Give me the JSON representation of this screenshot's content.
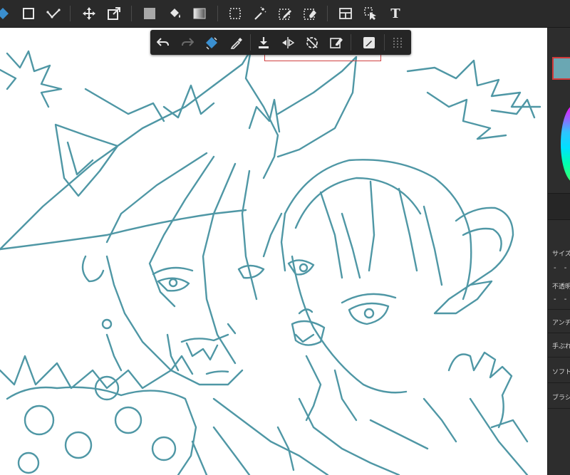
{
  "toolbar": {
    "text_tool_label": "T",
    "icons": [
      "fill-diamond-icon",
      "rectangle-icon",
      "checkmark-icon",
      "move-icon",
      "transform-icon",
      "gray-square-icon",
      "bucket-icon",
      "gradient-icon",
      "marquee-icon",
      "magic-wand-icon",
      "selection-pen-icon",
      "selection-eraser-icon",
      "layout-icon",
      "select-arrow-icon",
      "text-icon"
    ]
  },
  "floating_toolbar": {
    "icons": [
      "undo-icon",
      "redo-icon",
      "fill-icon",
      "eyedropper-icon",
      "download-icon",
      "flip-icon",
      "rotate-off-icon",
      "selection-edit-icon",
      "edit-square-icon",
      "grip-icon"
    ]
  },
  "side_panel": {
    "colors": {
      "current": "#6aa7b3",
      "highlight": "#d23a3a"
    },
    "labels": {
      "size": "サイズ",
      "opacity": "不透明度",
      "antialias": "アンチエイリアス",
      "stabilizer": "手ぶれ補正",
      "soft": "ソフト",
      "brush": "ブラシ"
    },
    "slider_glyph": "- -"
  },
  "canvas": {
    "line_color": "#4f97a5",
    "background": "#ffffff"
  }
}
